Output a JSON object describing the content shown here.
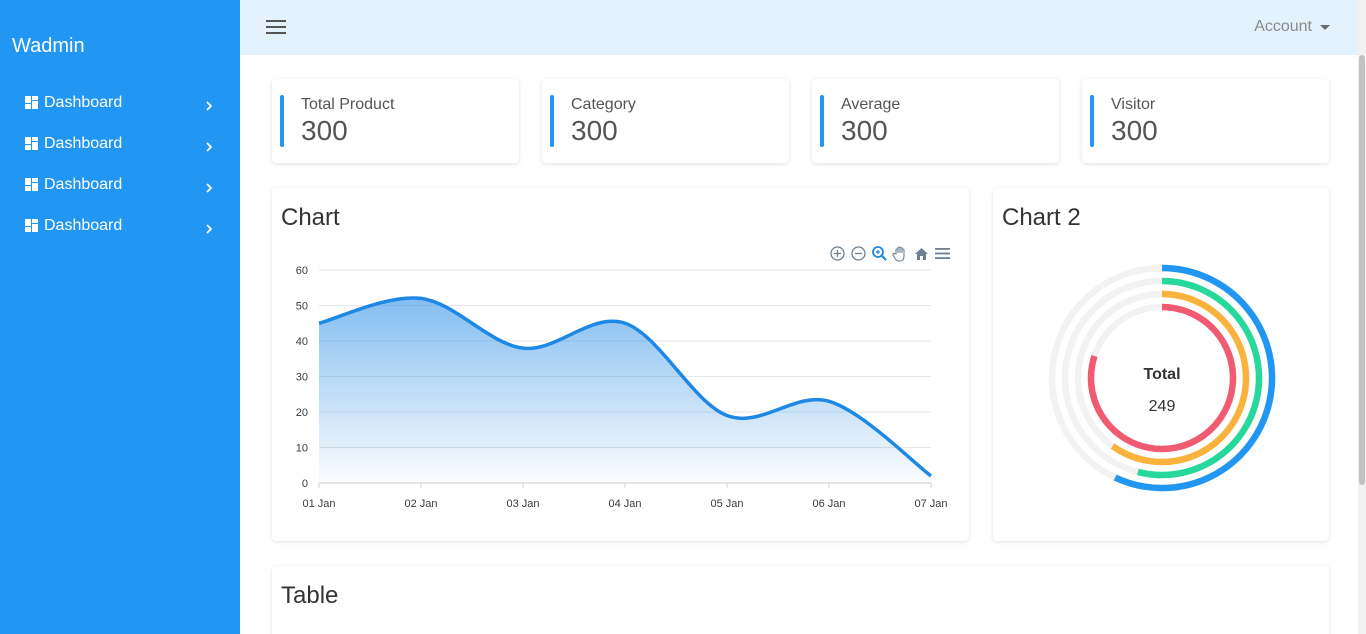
{
  "sidebar": {
    "brand": "Wadmin",
    "items": [
      {
        "label": "Dashboard"
      },
      {
        "label": "Dashboard"
      },
      {
        "label": "Dashboard"
      },
      {
        "label": "Dashboard"
      }
    ]
  },
  "topbar": {
    "account_label": "Account"
  },
  "stats": [
    {
      "label": "Total Product",
      "value": "300"
    },
    {
      "label": "Category",
      "value": "300"
    },
    {
      "label": "Average",
      "value": "300"
    },
    {
      "label": "Visitor",
      "value": "300"
    }
  ],
  "chart1": {
    "title": "Chart"
  },
  "chart2": {
    "title": "Chart 2",
    "center_label": "Total",
    "center_value": "249"
  },
  "table": {
    "title": "Table"
  },
  "colors": {
    "primary": "#2196f3",
    "topbar": "#e3f2fd",
    "line": "#1e88e5"
  },
  "chart_data": [
    {
      "type": "area",
      "x": [
        "01 Jan",
        "02 Jan",
        "03 Jan",
        "04 Jan",
        "05 Jan",
        "06 Jan",
        "07 Jan"
      ],
      "series": [
        {
          "values": [
            45,
            52,
            38,
            45,
            19,
            23,
            2
          ]
        }
      ],
      "ylim": [
        0,
        60
      ],
      "yticks": [
        0,
        10,
        20,
        30,
        40,
        50,
        60
      ],
      "grid": true
    },
    {
      "type": "radialBar",
      "center_label": "Total",
      "center_value": "249",
      "series": [
        {
          "color": "#2196f3",
          "value": 57
        },
        {
          "color": "#26d99a",
          "value": 54
        },
        {
          "color": "#f9b23c",
          "value": 60
        },
        {
          "color": "#f05b72",
          "value": 80
        }
      ],
      "max": 100
    }
  ]
}
